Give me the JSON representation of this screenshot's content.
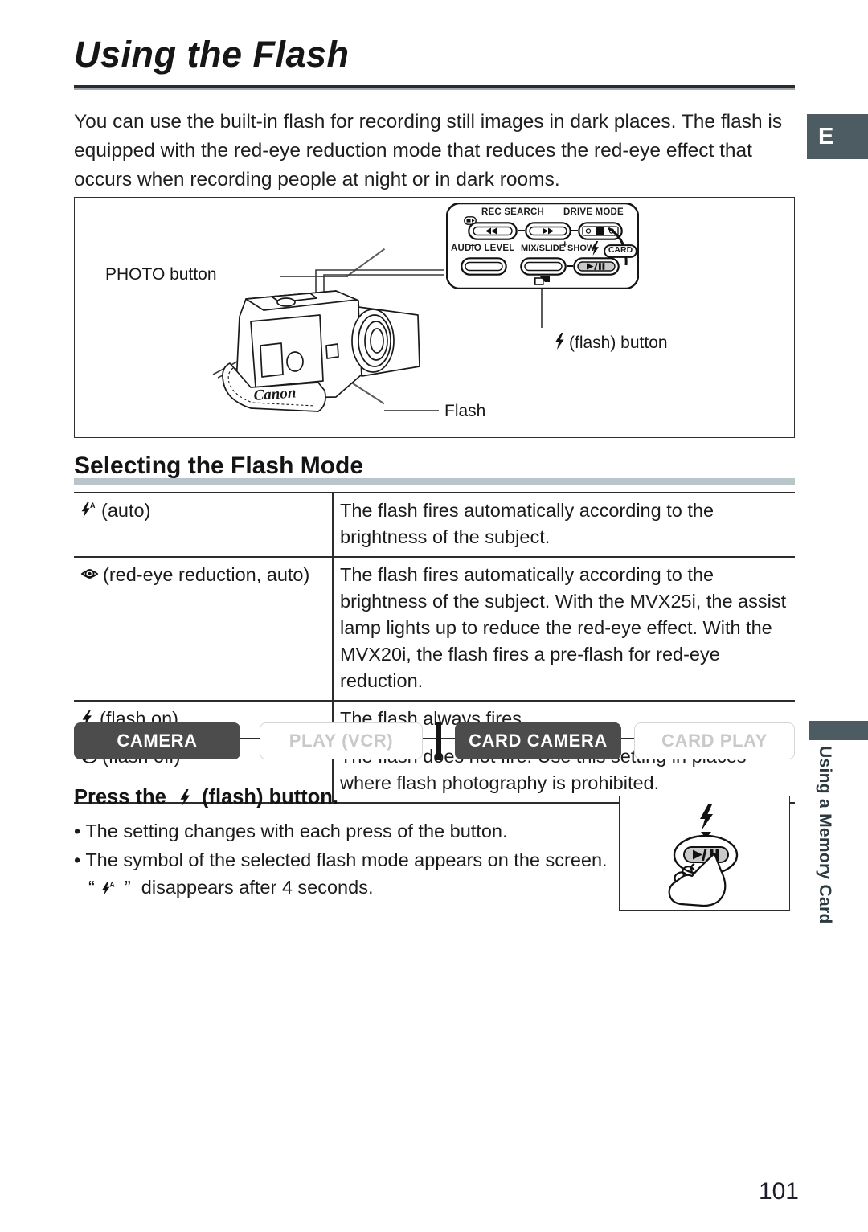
{
  "page": {
    "title": "Using the Flash",
    "language_badge": "E",
    "number": "101",
    "side_tab_label": "Using a Memory Card",
    "intro": "You can use the built-in flash for recording still images in dark places. The flash is equipped with the red-eye reduction mode that reduces the red-eye effect that occurs when recording people at night or in dark rooms."
  },
  "figure": {
    "labels": {
      "photo_button": "PHOTO button",
      "flash_button": "(flash) button",
      "flash": "Flash"
    },
    "brand": "Canon",
    "control_panel": {
      "rec_search": "REC SEARCH",
      "drive_mode": "DRIVE MODE",
      "audio_level": "AUDIO LEVEL",
      "mix_slide_show": "MIX/SLIDE SHOW",
      "card": "CARD",
      "minus": "–",
      "plus": "+"
    }
  },
  "section": {
    "heading": "Selecting the Flash Mode",
    "table": {
      "rows": [
        {
          "icon": "flash-auto-icon",
          "mode": "(auto)",
          "description": "The flash fires automatically according to the brightness of the subject."
        },
        {
          "icon": "red-eye-reduction-icon",
          "mode": "(red-eye reduction, auto)",
          "description": "The flash fires automatically according to the brightness of the subject. With the MVX25i, the assist lamp lights up to reduce the red-eye effect. With the MVX20i, the flash fires a pre-flash for red-eye reduction."
        },
        {
          "icon": "flash-on-icon",
          "mode": "(flash on)",
          "description": "The flash always fires."
        },
        {
          "icon": "flash-off-icon",
          "mode": "(flash off)",
          "description": "The flash does not fire. Use this setting in places where flash photography is prohibited."
        }
      ]
    }
  },
  "mode_badges": [
    {
      "label": "CAMERA",
      "active": true
    },
    {
      "label": "PLAY (VCR)",
      "active": false
    },
    {
      "label": "CARD CAMERA",
      "active": true
    },
    {
      "label": "CARD PLAY",
      "active": false
    }
  ],
  "instructions": {
    "heading_before": "Press the",
    "heading_after": "(flash) button.",
    "bullets": [
      "• The setting changes with each press of the button.",
      "• The symbol of the selected flash mode appears on the screen.",
      "“ ” disappears after 4 seconds."
    ]
  },
  "colors": {
    "badge_bg": "#4c5c62",
    "rule": "#b9c6c9",
    "active_badge": "#4c4c4c",
    "inactive_badge_text": "#c9c9c9"
  }
}
